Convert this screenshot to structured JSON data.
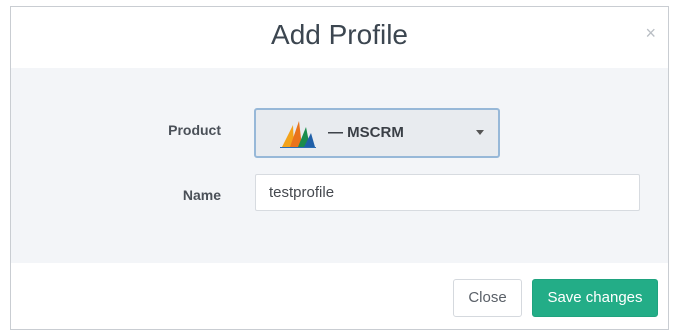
{
  "modal": {
    "title": "Add Profile",
    "close_glyph": "×"
  },
  "form": {
    "product": {
      "label": "Product",
      "selected_value": "— MSCRM",
      "logo_icon": "dynamics-crm-logo-icon"
    },
    "name": {
      "label": "Name",
      "value": "testprofile"
    }
  },
  "footer": {
    "close_label": "Close",
    "save_label": "Save changes"
  },
  "colors": {
    "save_button": "#23ad87",
    "select_border": "#97b8d8",
    "body_background": "#f3f5f8"
  }
}
